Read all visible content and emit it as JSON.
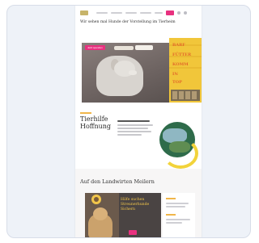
{
  "page": {
    "intro_text": "Wir sehen mal Hunde der Vorstellung im Tierheim",
    "hero": {
      "pill_label": "Jetzt spenden",
      "ad_lines": [
        "BARF",
        "FÜTTER",
        "KOMM",
        "IN",
        "TOP"
      ]
    },
    "section2": {
      "title_line1": "Tierhilfe",
      "title_line2": "Hoffnung"
    },
    "section3": {
      "title": "Auf den Landwirten Meilern",
      "card_text": [
        "Hilfe suchen",
        "Streunerhunde",
        "Sichern"
      ]
    }
  },
  "colors": {
    "accent": "#e8317f",
    "yellow": "#f1c63a",
    "gold": "#f0b64a"
  }
}
